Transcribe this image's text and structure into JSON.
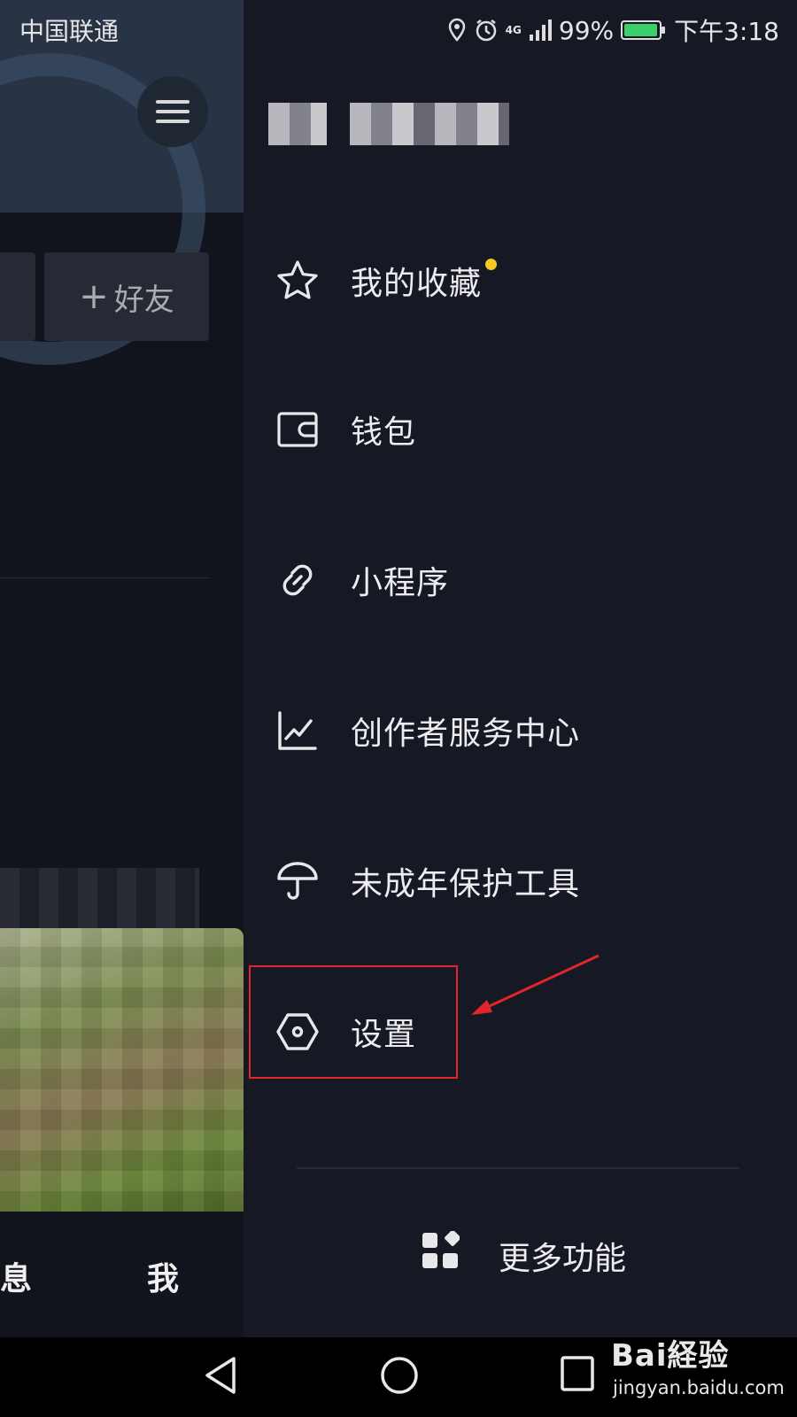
{
  "status_bar": {
    "carrier": "中国联通",
    "network": "4G",
    "battery": "99%",
    "time": "下午3:18"
  },
  "left_panel": {
    "add_friend": "好友",
    "bottom_tab_1": "消息",
    "bottom_tab_2": "我"
  },
  "drawer": {
    "items": [
      {
        "label": "我的收藏",
        "icon": "star-icon",
        "badge": true
      },
      {
        "label": "钱包",
        "icon": "wallet-icon"
      },
      {
        "label": "小程序",
        "icon": "link-icon"
      },
      {
        "label": "创作者服务中心",
        "icon": "chart-icon"
      },
      {
        "label": "未成年保护工具",
        "icon": "umbrella-icon"
      },
      {
        "label": "设置",
        "icon": "settings-hexagon-icon",
        "highlighted": true
      }
    ],
    "more_label": "更多功能"
  },
  "colors": {
    "background": "#161823",
    "badge": "#f7c928",
    "highlight": "#e0262b",
    "battery": "#3ad16d"
  },
  "watermark": {
    "brand": "Bai経验",
    "site": "jingyan.baidu.com"
  }
}
